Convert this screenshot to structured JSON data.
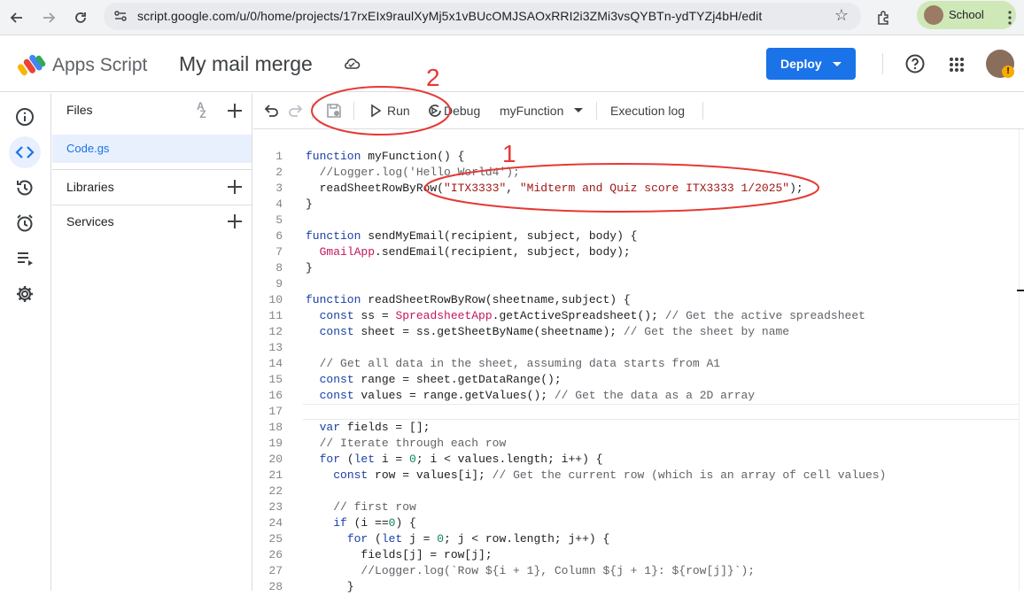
{
  "browser": {
    "url": "script.google.com/u/0/home/projects/17rxEIx9raulXyMj5x1vBUcOMJSAOxRRI2i3ZMi3vsQYBTn-ydTYZj4bH/edit",
    "profile_label": "School"
  },
  "header": {
    "app_name": "Apps Script",
    "project_name": "My mail merge",
    "deploy_label": "Deploy"
  },
  "files_panel": {
    "files_title": "Files",
    "file_name": "Code.gs",
    "libraries_title": "Libraries",
    "services_title": "Services"
  },
  "toolbar": {
    "run_label": "Run",
    "debug_label": "Debug",
    "function_select": "myFunction",
    "execution_log_label": "Execution log"
  },
  "code_lines": [
    "function myFunction() {",
    "  //Logger.log('Hello World4');",
    "  readSheetRowByRow(\"ITX3333\", \"Midterm and Quiz score ITX3333 1/2025\");",
    "}",
    "",
    "function sendMyEmail(recipient, subject, body) {",
    "  GmailApp.sendEmail(recipient, subject, body);",
    "}",
    "",
    "function readSheetRowByRow(sheetname,subject) {",
    "  const ss = SpreadsheetApp.getActiveSpreadsheet(); // Get the active spreadsheet",
    "  const sheet = ss.getSheetByName(sheetname); // Get the sheet by name",
    "",
    "  // Get all data in the sheet, assuming data starts from A1",
    "  const range = sheet.getDataRange();",
    "  const values = range.getValues(); // Get the data as a 2D array",
    "",
    "  var fields = [];",
    "  // Iterate through each row",
    "  for (let i = 0; i < values.length; i++) {",
    "    const row = values[i]; // Get the current row (which is an array of cell values)",
    "",
    "    // first row",
    "    if (i ==0) {",
    "      for (let j = 0; j < row.length; j++) {",
    "        fields[j] = row[j];",
    "        //Logger.log(`Row ${i + 1}, Column ${j + 1}: ${row[j]}`);",
    "      }"
  ],
  "annotations": [
    "1",
    "2"
  ]
}
